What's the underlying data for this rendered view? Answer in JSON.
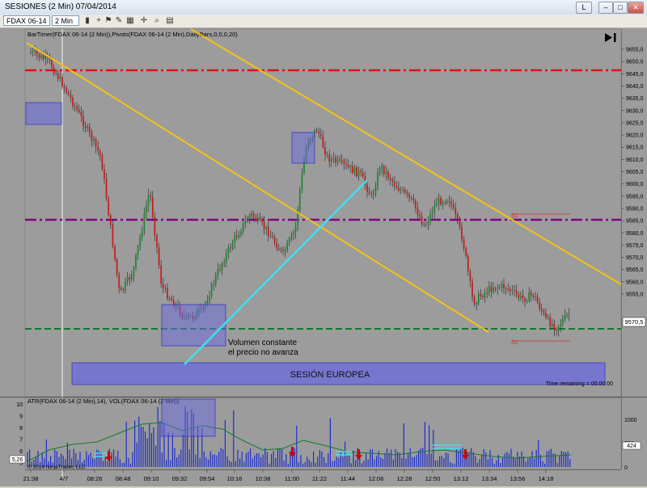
{
  "window": {
    "title": "SESIONES (2 Min)  07/04/2014",
    "btn_l": "L"
  },
  "toolbar": {
    "instrument": "FDAX 06-14",
    "interval": "2 Min"
  },
  "chart": {
    "indicator_label": "BarTimer(FDAX 06-14 (2 Min)),Pivots(FDAX 06-14 (2 Min),DailyBars,0,0,0,20)",
    "price_ticks": [
      "9655,0",
      "9650,0",
      "9645,0",
      "9640,0",
      "9635,0",
      "9630,0",
      "9625,0",
      "9620,0",
      "9615,0",
      "9610,0",
      "9605,0",
      "9600,0",
      "9595,0",
      "9590,0",
      "9585,0",
      "9580,0",
      "9575,0",
      "9570,0",
      "9565,0",
      "9560,0",
      "9555,0"
    ],
    "current_price": "9570,5",
    "annotation": {
      "line1": "Volumen constante",
      "line2": "el precio no avanza"
    },
    "session_label": "SESIÓN EUROPEA",
    "s1": "S1",
    "s2": "S2",
    "time_remaining": "Time remaining = 00:00:00",
    "colors": {
      "resistance": "#e01010",
      "pivot": "#800080",
      "support": "#0f7a2a",
      "channel": "#f2c21a",
      "trend": "#3fe0f0",
      "box": "#6a6ae0"
    }
  },
  "lower": {
    "label": "ATR(FDAX 06-14 (2 Min),14), VOL(FDAX 06-14 (2 Min))",
    "copyright": "© 2014 NinjaTrader, LLC",
    "left_ticks": [
      "10",
      "9",
      "8",
      "7",
      "6",
      "5"
    ],
    "right_ticks": [
      "1000",
      "500",
      "0"
    ],
    "atr_value": "5,26",
    "vol_value": "424"
  },
  "time_axis": [
    "21:38",
    "4/7",
    "08:26",
    "08:48",
    "09:10",
    "09:32",
    "09:54",
    "10:16",
    "10:38",
    "11:00",
    "11:22",
    "11:44",
    "12:06",
    "12:28",
    "12:50",
    "13:12",
    "13:34",
    "13:56",
    "14:18"
  ]
}
